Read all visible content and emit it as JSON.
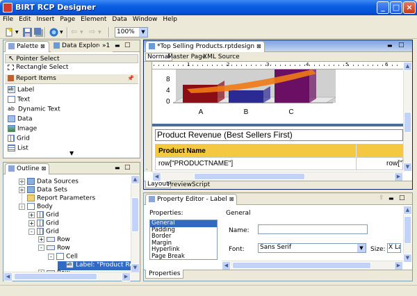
{
  "window": {
    "title": "BIRT RCP Designer"
  },
  "menu": [
    "File",
    "Edit",
    "Insert",
    "Page",
    "Element",
    "Data",
    "Window",
    "Help"
  ],
  "toolbar": {
    "zoom": "100%"
  },
  "palette": {
    "tabs": [
      "Palette",
      "Data Explorer",
      "»1"
    ],
    "tools": [
      "Pointer Select",
      "Rectangle Select"
    ],
    "drawer_title": "Report Items",
    "items": [
      "Label",
      "Text",
      "Dynamic Text",
      "Data",
      "Image",
      "Grid",
      "List"
    ]
  },
  "outline": {
    "tab": "Outline",
    "nodes": [
      {
        "label": "Data Sources",
        "level": 0,
        "toggle": "+"
      },
      {
        "label": "Data Sets",
        "level": 0,
        "toggle": "+"
      },
      {
        "label": "Report Parameters",
        "level": 0,
        "toggle": ""
      },
      {
        "label": "Body",
        "level": 0,
        "toggle": "-"
      },
      {
        "label": "Grid",
        "level": 1,
        "toggle": "+"
      },
      {
        "label": "Grid",
        "level": 1,
        "toggle": "+"
      },
      {
        "label": "Grid",
        "level": 1,
        "toggle": "-"
      },
      {
        "label": "Row",
        "level": 2,
        "toggle": "+"
      },
      {
        "label": "Row",
        "level": 2,
        "toggle": "-"
      },
      {
        "label": "Cell",
        "level": 3,
        "toggle": "-"
      },
      {
        "label": "Label: \"Product Reve...",
        "level": 4,
        "toggle": ""
      },
      {
        "label": "Row",
        "level": 2,
        "toggle": "+"
      }
    ]
  },
  "editor": {
    "file_tab": "*Top Selling Products.rptdesign",
    "views": [
      "Normal",
      "Master Page",
      "XML Source"
    ],
    "bottom_tabs": [
      "Layout",
      "Preview",
      "Script"
    ],
    "ruler_marks": [
      "1",
      "2",
      "3",
      "4",
      "5",
      "6"
    ],
    "report_title": "Product Revenue (Best Sellers First)",
    "table_header": "Product Name",
    "table_cell_1": "row[\"PRODUCTNAME\"]",
    "table_cell_2": "row[\"T"
  },
  "chart_data": {
    "type": "bar",
    "categories": [
      "A",
      "B",
      "C"
    ],
    "y_ticks": [
      "0",
      "4",
      "8"
    ],
    "title": "",
    "xlabel": "",
    "ylabel": ""
  },
  "property_editor": {
    "tab": "Property Editor - Label",
    "properties_label": "Properties:",
    "section_title": "General",
    "categories": [
      "General",
      "Padding",
      "Border",
      "Margin",
      "Hyperlink",
      "Page Break"
    ],
    "name_label": "Name:",
    "name_value": "",
    "font_label": "Font:",
    "font_value": "Sans Serif",
    "size_label": "Size:",
    "size_value": "X La",
    "bottom_tab": "Properties"
  },
  "colors": {
    "title_bar": "#0553d6",
    "table_header_bg": "#f5c842",
    "selection": "#316ac5",
    "bar_red": "#8b0d16",
    "bar_blue": "#2b2a92",
    "bar_purple": "#6a0f63",
    "swoosh": "#f07a16"
  }
}
